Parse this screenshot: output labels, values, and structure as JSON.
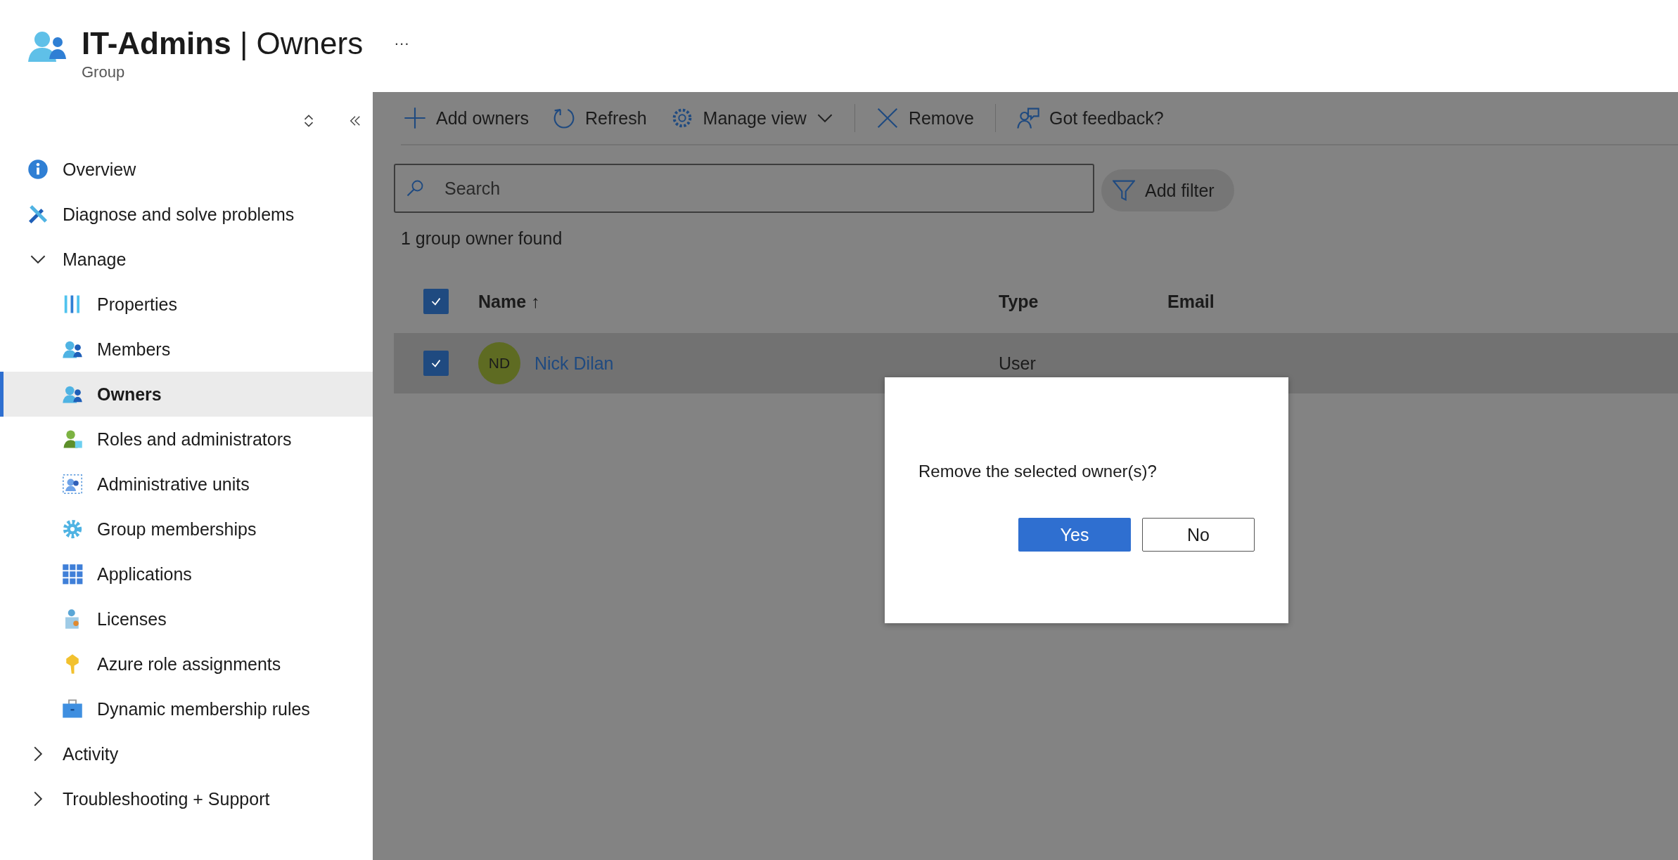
{
  "header": {
    "title_bold": "IT-Admins",
    "title_rest": "| Owners",
    "subtitle": "Group",
    "more": "···"
  },
  "sidebar": {
    "items": [
      {
        "label": "Overview",
        "selected": false
      },
      {
        "label": "Diagnose and solve problems",
        "selected": false
      },
      {
        "label": "Manage",
        "kind": "group",
        "expanded": true,
        "children": [
          {
            "label": "Properties",
            "selected": false
          },
          {
            "label": "Members",
            "selected": false
          },
          {
            "label": "Owners",
            "selected": true
          },
          {
            "label": "Roles and administrators",
            "selected": false
          },
          {
            "label": "Administrative units",
            "selected": false
          },
          {
            "label": "Group memberships",
            "selected": false
          },
          {
            "label": "Applications",
            "selected": false
          },
          {
            "label": "Licenses",
            "selected": false
          },
          {
            "label": "Azure role assignments",
            "selected": false
          },
          {
            "label": "Dynamic membership rules",
            "selected": false
          }
        ]
      },
      {
        "label": "Activity",
        "kind": "group",
        "expanded": false
      },
      {
        "label": "Troubleshooting + Support",
        "kind": "group",
        "expanded": false
      }
    ]
  },
  "toolbar": [
    {
      "label": "Add owners"
    },
    {
      "label": "Refresh"
    },
    {
      "label": "Manage view",
      "dropdown": true
    },
    {
      "label": "Remove",
      "separator": true
    },
    {
      "label": "Got feedback?",
      "separator": true
    }
  ],
  "search": {
    "placeholder": "Search"
  },
  "filter_button": "Add filter",
  "result_count": "1 group owner found",
  "table": {
    "all_checked": true,
    "columns": [
      "Name ↑",
      "Type",
      "Email"
    ],
    "rows": [
      {
        "initials": "ND",
        "name": "Nick Dilan",
        "type": "User",
        "checked": true,
        "selected": true
      }
    ]
  },
  "dialog": {
    "message": "Remove the selected owner(s)?",
    "buttons": [
      {
        "label": "Yes",
        "kind": "primary"
      },
      {
        "label": "No",
        "kind": "secondary"
      }
    ]
  }
}
